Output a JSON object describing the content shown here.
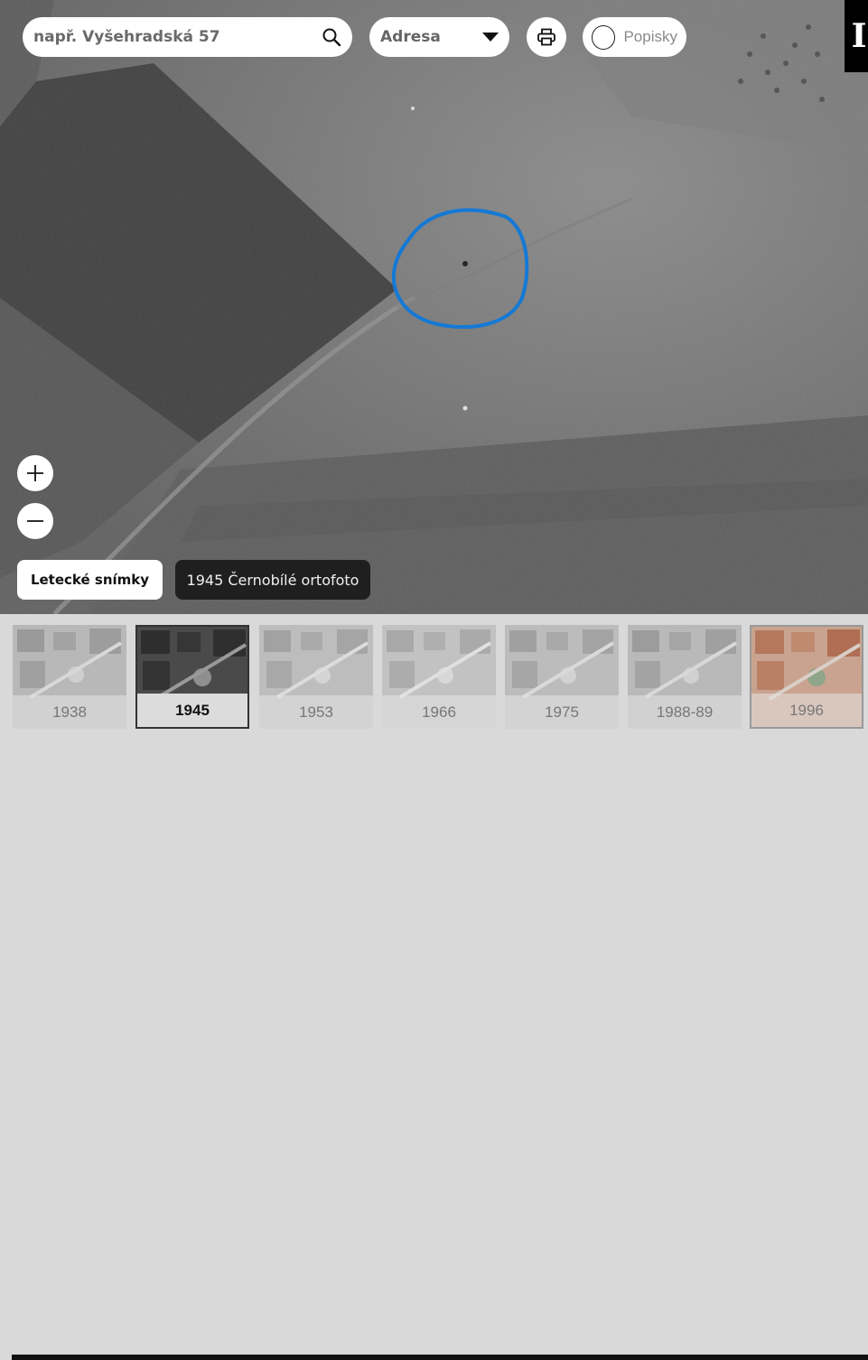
{
  "search": {
    "placeholder": "např. Vyšehradská 57",
    "value": ""
  },
  "search_mode": {
    "selected": "Adresa"
  },
  "labels_toggle": {
    "label": "Popisky",
    "on": false
  },
  "logo": {
    "letter": "I"
  },
  "layer": {
    "button_label": "Letecké snímky",
    "current": "1945 Černobílé ortofoto"
  },
  "timeline": {
    "years": [
      "1938",
      "1945",
      "1953",
      "1966",
      "1975",
      "1988-89",
      "1996"
    ],
    "selected": "1945"
  },
  "colors": {
    "highlight": "#1479d6",
    "panel": "#d9d9d9",
    "active_border": "#333333"
  },
  "icons": {
    "search": "search-icon",
    "dropdown": "chevron-down-icon",
    "print": "printer-icon",
    "toggle": "circle-toggle-icon",
    "zoom_in": "plus-icon",
    "zoom_out": "minus-icon"
  }
}
